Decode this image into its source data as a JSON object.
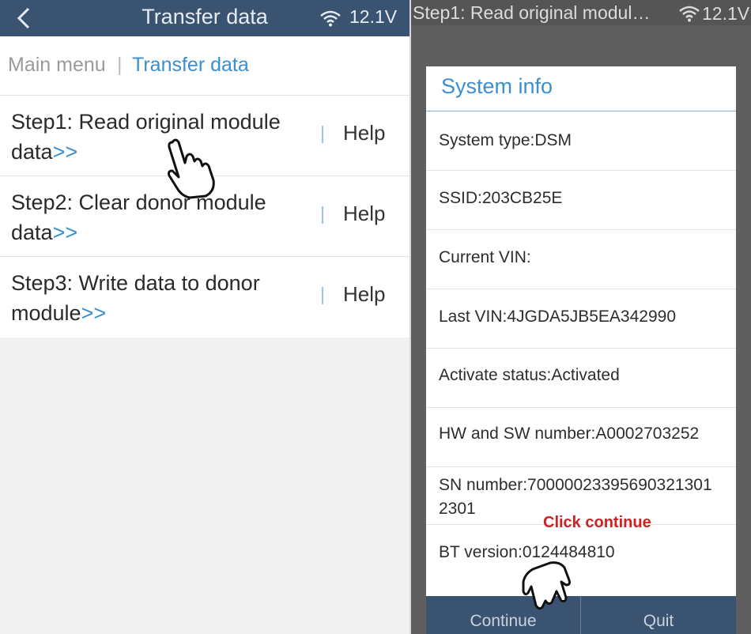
{
  "left": {
    "header": {
      "title": "Transfer data",
      "voltage": "12.1V"
    },
    "breadcrumb": {
      "main": "Main menu",
      "separator": "|",
      "current": "Transfer data"
    },
    "steps": [
      {
        "line1": "Step1: Read original module",
        "line2": "data",
        "arrow": ">>",
        "help": "Help"
      },
      {
        "line1": "Step2: Clear donor module",
        "line2": "data",
        "arrow": ">>",
        "help": "Help"
      },
      {
        "line1": "Step3: Write data to donor",
        "line2": "module",
        "arrow": ">>",
        "help": "Help"
      }
    ]
  },
  "right": {
    "header": {
      "title": "Step1: Read original modul…",
      "voltage": "12.1V"
    },
    "dialog": {
      "title": "System info",
      "rows": [
        "System type:DSM",
        "SSID:203CB25E",
        "Current VIN:",
        "Last VIN:4JGDA5JB5EA342990",
        "Activate status:Activated",
        "HW and SW number:A0002703252",
        "SN number:70000023395690321301",
        "2301",
        "BT version:0124484810"
      ],
      "annotation": "Click continue",
      "continue_label": "Continue",
      "quit_label": "Quit"
    }
  },
  "colors": {
    "header": "#3a5370",
    "accent": "#3a8fd0",
    "annotation": "#cc2222"
  },
  "icons": [
    "back-arrow-icon",
    "wifi-icon",
    "pointing-hand-icon"
  ]
}
